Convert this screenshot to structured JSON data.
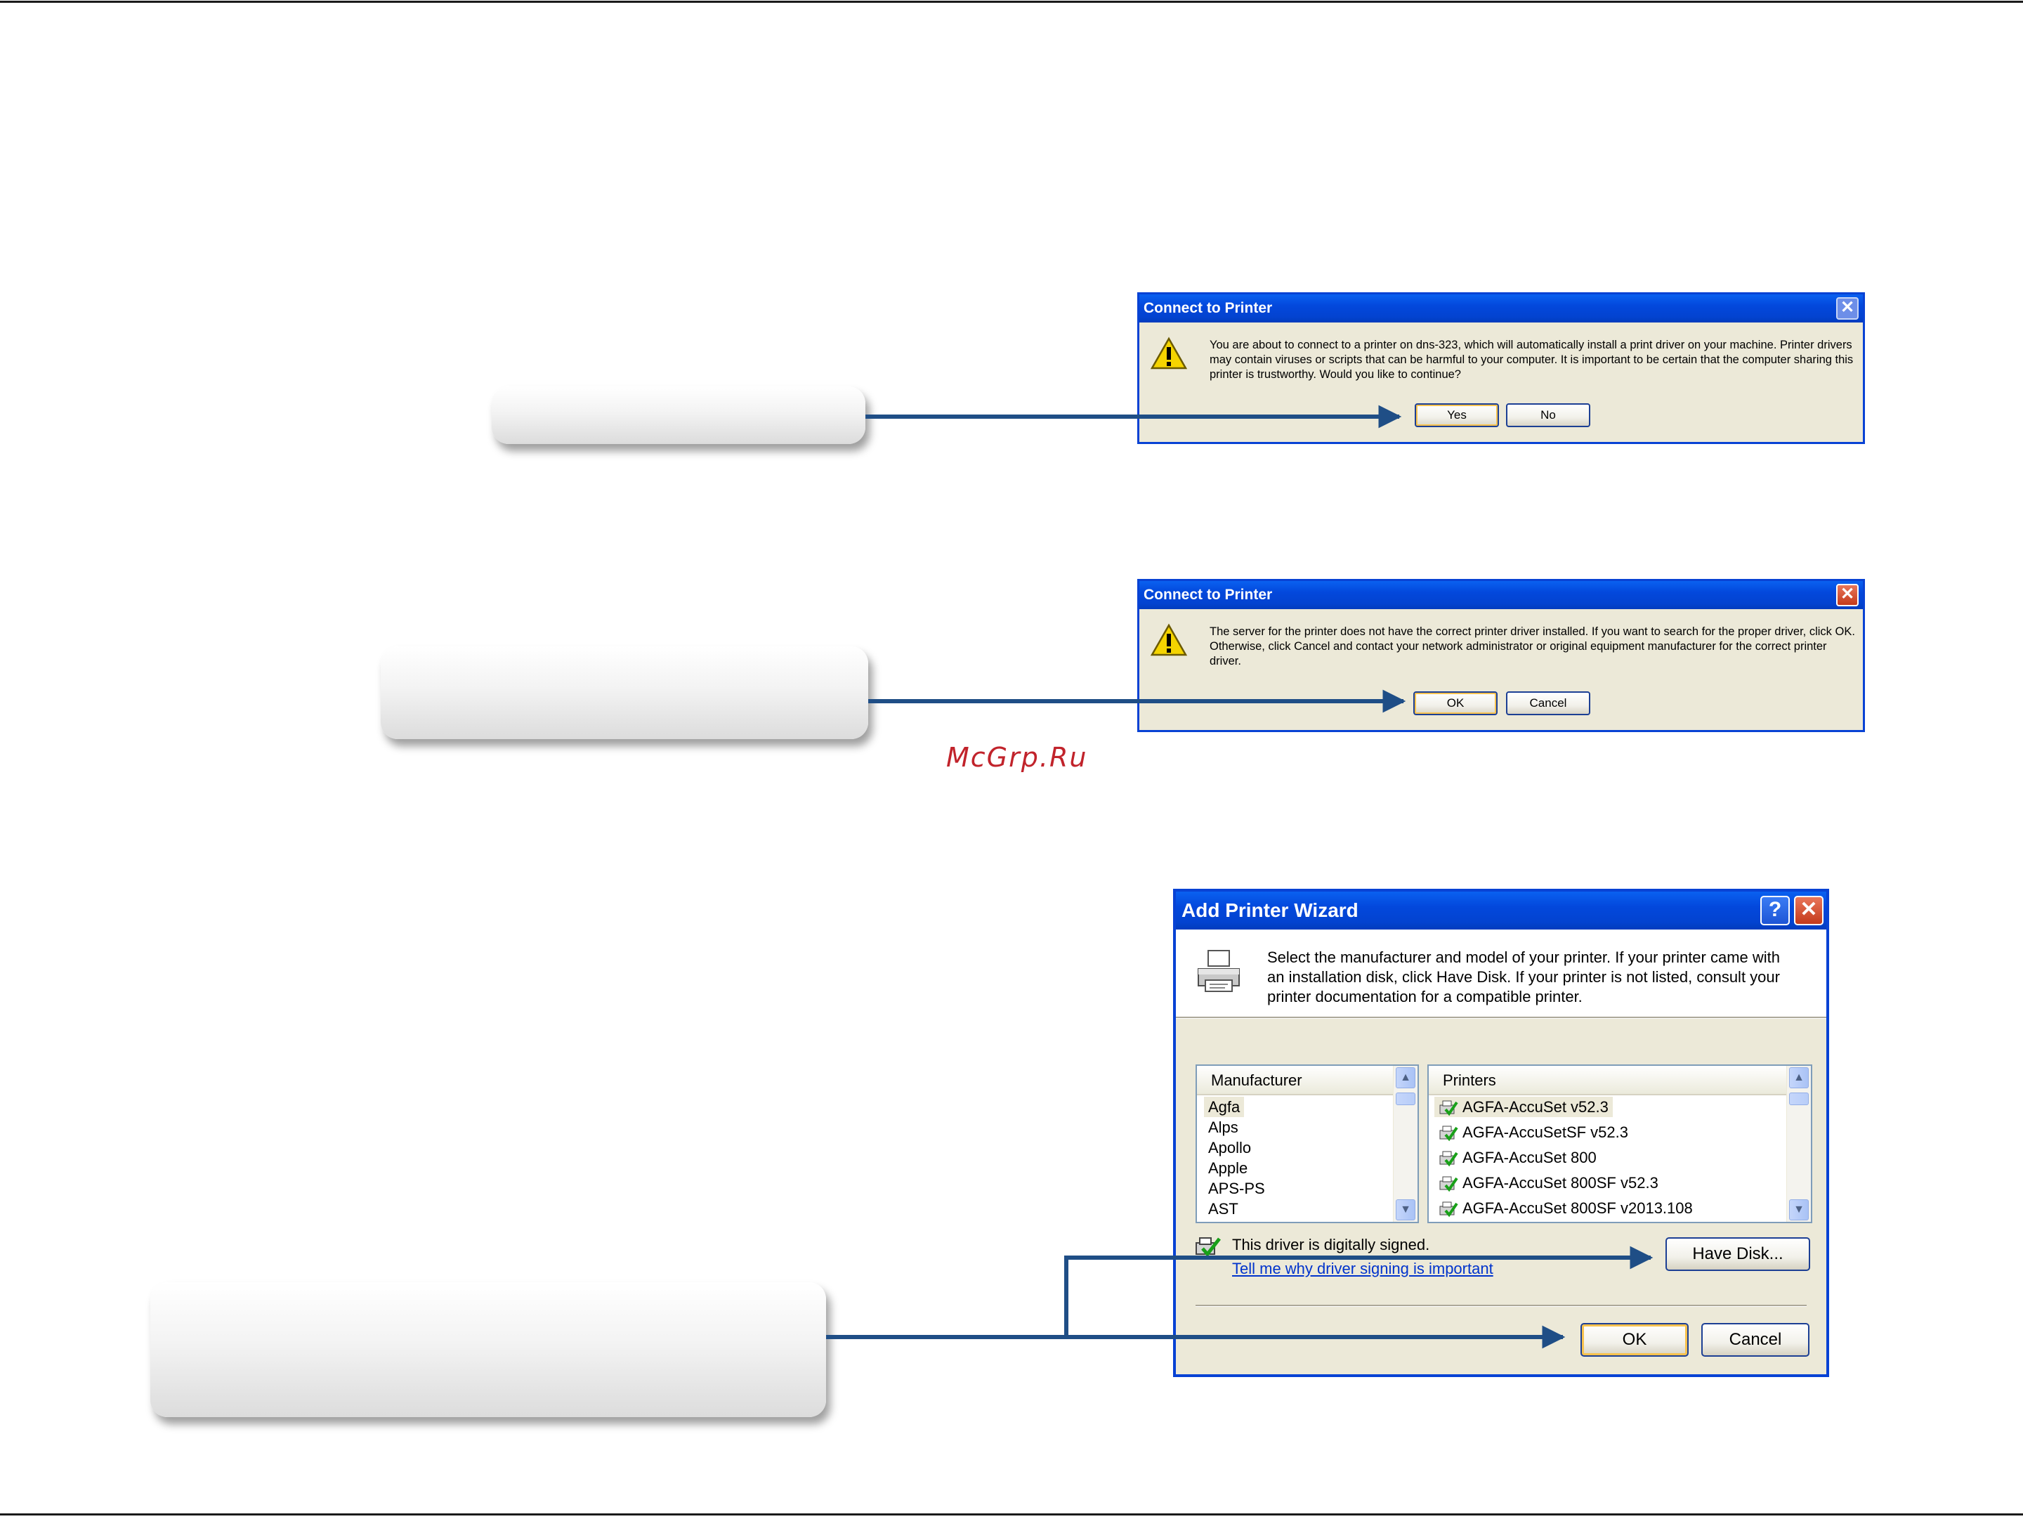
{
  "dialog1": {
    "title": "Connect to Printer",
    "message": "You are about to connect to a printer on dns-323, which will automatically install a print driver on your machine. Printer drivers may contain viruses or scripts that can be harmful to your computer.  It is important to be certain that the computer sharing this printer is trustworthy.  Would you like to continue?",
    "yes_label": "Yes",
    "no_label": "No"
  },
  "dialog2": {
    "title": "Connect to Printer",
    "message": "The server for the printer does not have the correct printer driver installed.  If you want to search for the proper driver, click OK.  Otherwise, click Cancel and contact your network administrator or original equipment manufacturer for the correct printer driver.",
    "ok_label": "OK",
    "cancel_label": "Cancel"
  },
  "wizard": {
    "title": "Add Printer Wizard",
    "help_glyph": "?",
    "close_glyph": "✕",
    "intro": "Select the manufacturer and model of your printer. If your printer came with an installation disk, click Have Disk. If your printer is not listed, consult your printer documentation for a compatible printer.",
    "manufacturer_header": "Manufacturer",
    "manufacturers": [
      "Agfa",
      "Alps",
      "Apollo",
      "Apple",
      "APS-PS",
      "AST"
    ],
    "printers_header": "Printers",
    "printers": [
      "AGFA-AccuSet v52.3",
      "AGFA-AccuSetSF v52.3",
      "AGFA-AccuSet 800",
      "AGFA-AccuSet 800SF v52.3",
      "AGFA-AccuSet 800SF v2013.108"
    ],
    "signed_text": "This driver is digitally signed.",
    "signing_link": "Tell me why driver signing is important",
    "have_disk_label": "Have Disk...",
    "ok_label": "OK",
    "cancel_label": "Cancel"
  },
  "watermark": "McGrp.Ru",
  "colors": {
    "arrow": "#1f4e86",
    "title_bar": "#0348dc",
    "dialog_face": "#ece9d8",
    "watermark": "#c1232b"
  }
}
